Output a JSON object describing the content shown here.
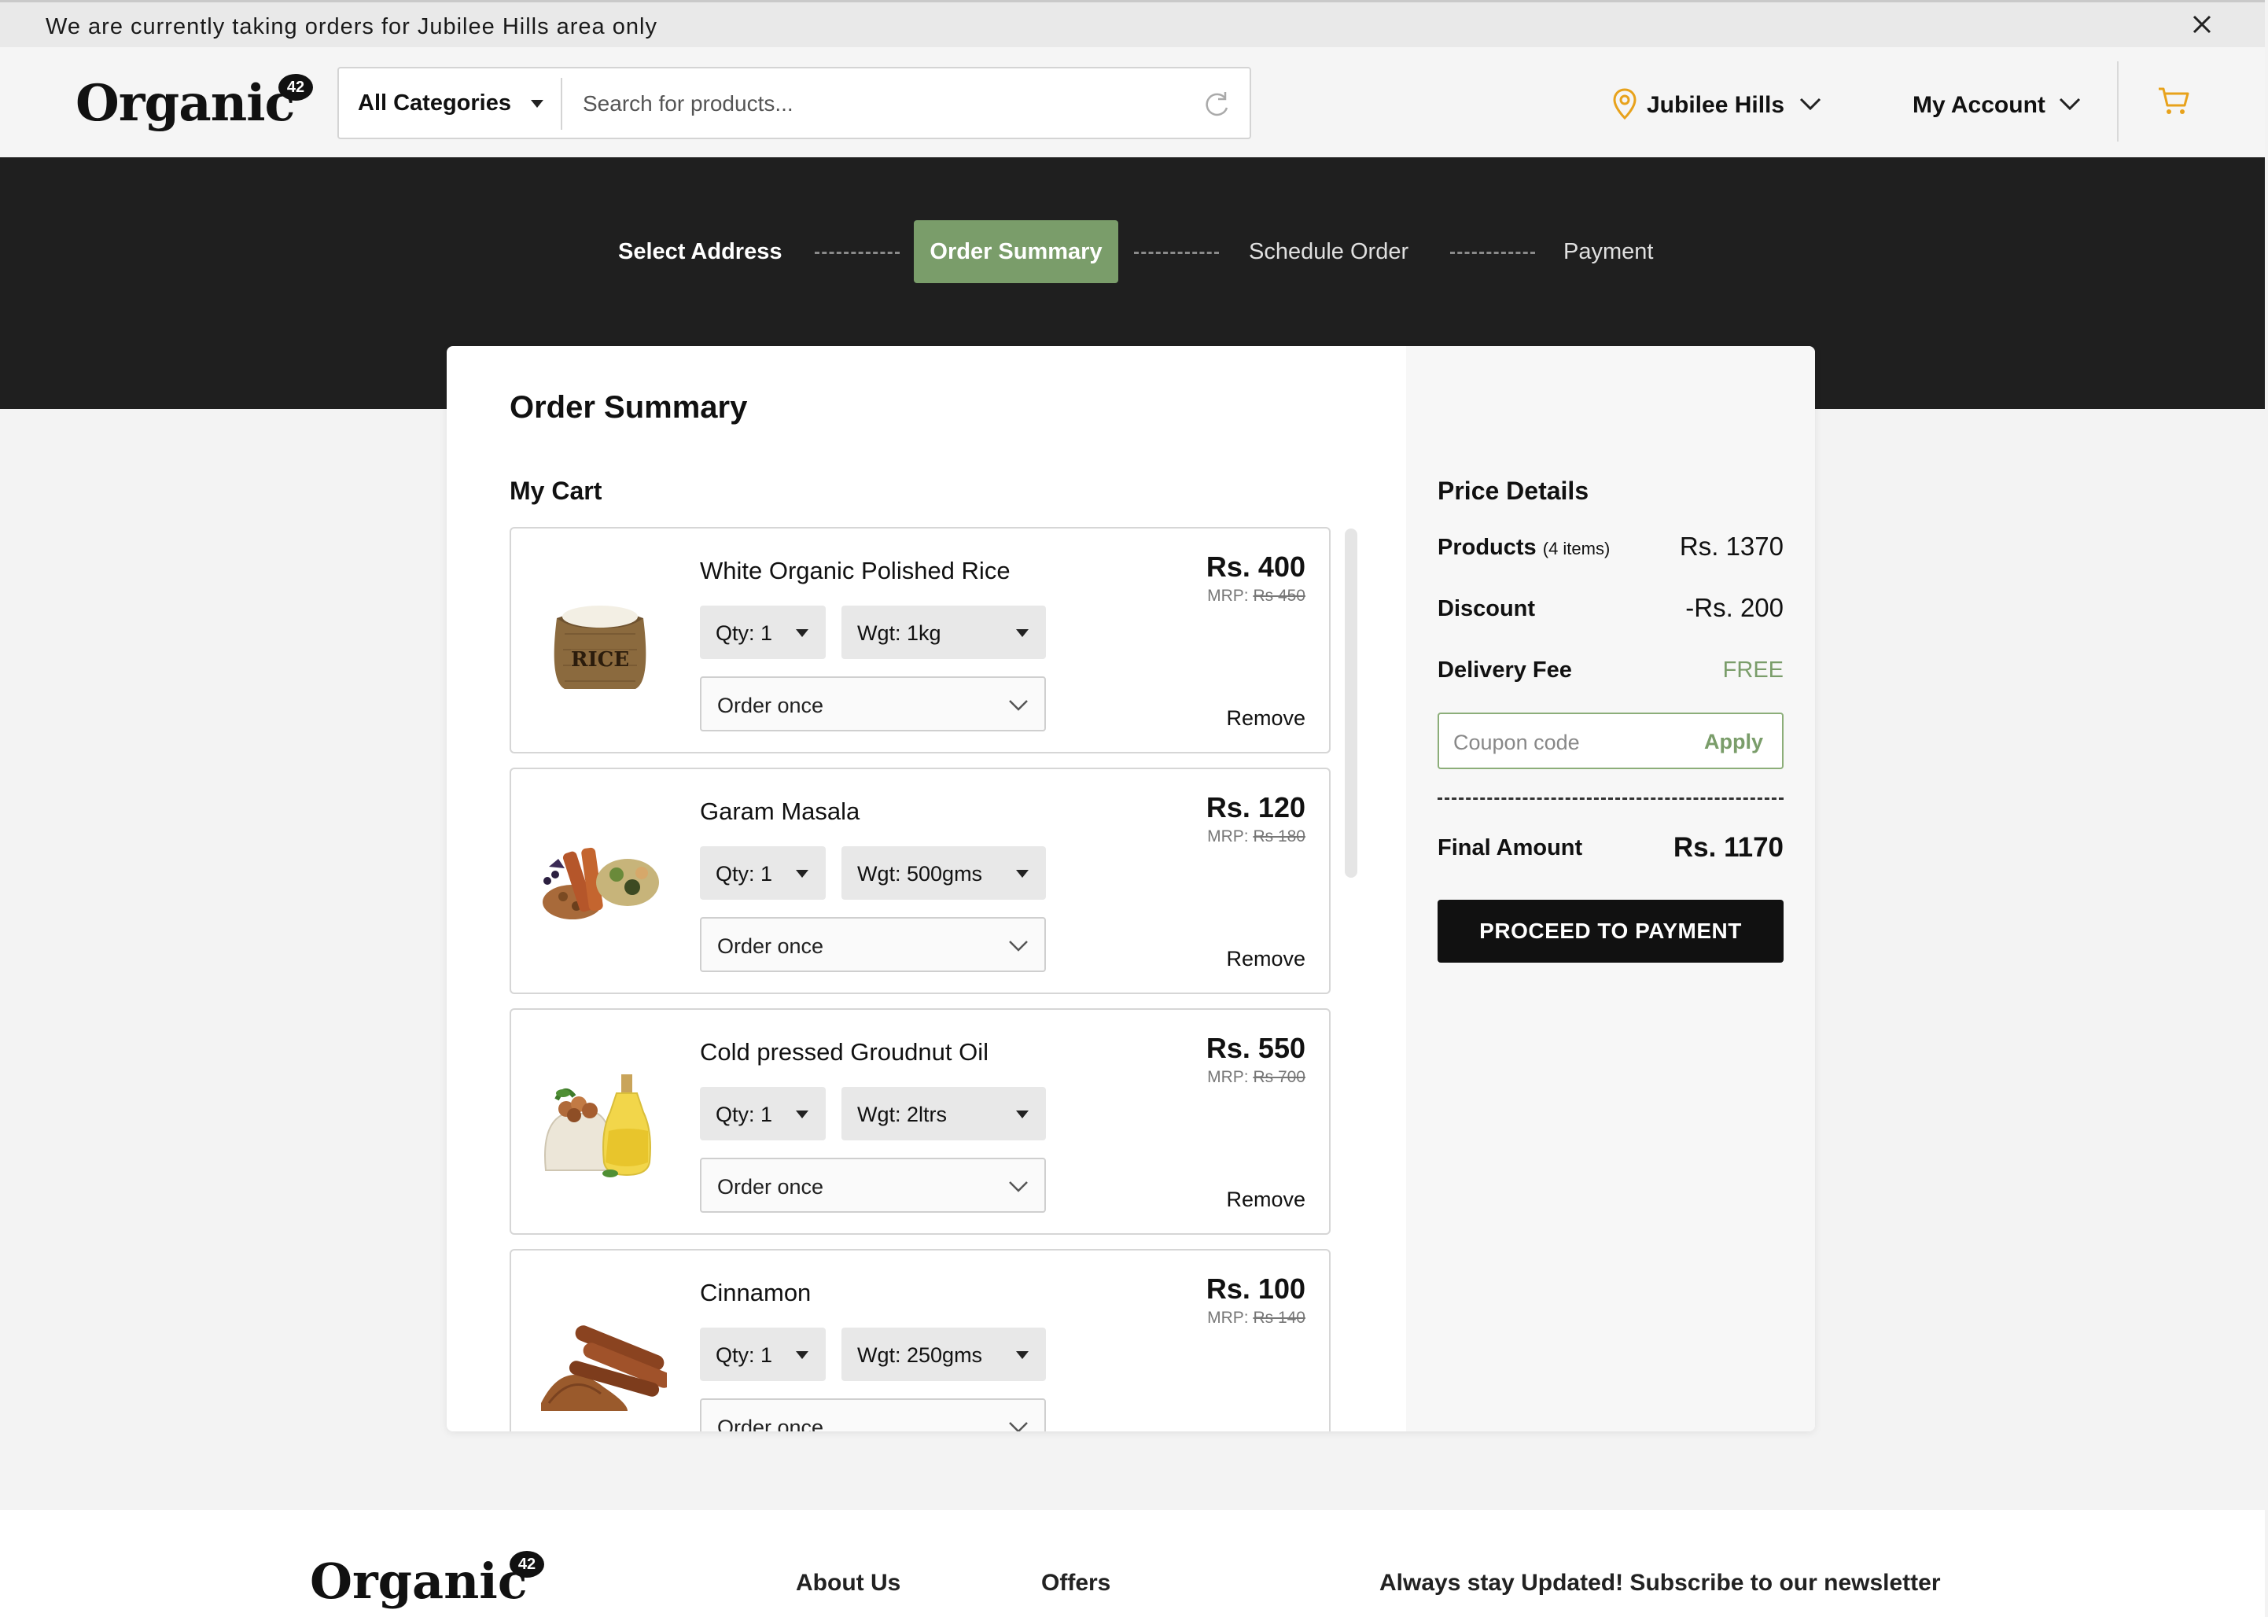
{
  "announcement": {
    "text": "We are currently taking orders for Jubilee Hills area only"
  },
  "header": {
    "logo_text": "Organic",
    "logo_badge": "42",
    "category_label": "All Categories",
    "search_placeholder": "Search for products...",
    "location_label": "Jubilee Hills",
    "account_label": "My Account"
  },
  "steps": [
    {
      "label": "Select Address",
      "state": "done"
    },
    {
      "label": "Order Summary",
      "state": "active"
    },
    {
      "label": "Schedule Order",
      "state": "pending"
    },
    {
      "label": "Payment",
      "state": "pending"
    }
  ],
  "order": {
    "title": "Order Summary",
    "cart_heading": "My Cart",
    "remove_label": "Remove",
    "items": [
      {
        "name": "White Organic Polished Rice",
        "qty": "Qty: 1",
        "weight": "Wgt: 1kg",
        "frequency": "Order once",
        "price": "Rs. 400",
        "mrp_label": "MRP:",
        "mrp": "Rs 450"
      },
      {
        "name": "Garam Masala",
        "qty": "Qty: 1",
        "weight": "Wgt: 500gms",
        "frequency": "Order once",
        "price": "Rs. 120",
        "mrp_label": "MRP:",
        "mrp": "Rs 180"
      },
      {
        "name": "Cold pressed Groudnut Oil",
        "qty": "Qty: 1",
        "weight": "Wgt: 2ltrs",
        "frequency": "Order once",
        "price": "Rs. 550",
        "mrp_label": "MRP:",
        "mrp": "Rs 700"
      },
      {
        "name": "Cinnamon",
        "qty": "Qty: 1",
        "weight": "Wgt: 250gms",
        "frequency": "Order once",
        "price": "Rs. 100",
        "mrp_label": "MRP:",
        "mrp": "Rs 140"
      }
    ]
  },
  "price_details": {
    "title": "Price Details",
    "products_label": "Products",
    "products_count": "(4 items)",
    "products_value": "Rs. 1370",
    "discount_label": "Discount",
    "discount_value": "-Rs. 200",
    "delivery_label": "Delivery Fee",
    "delivery_value": "FREE",
    "coupon_placeholder": "Coupon code",
    "apply_label": "Apply",
    "final_label": "Final Amount",
    "final_value": "Rs. 1170",
    "proceed_label": "PROCEED TO PAYMENT"
  },
  "footer": {
    "logo_text": "Organic",
    "logo_badge": "42",
    "links": [
      "About Us",
      "Offers"
    ],
    "newsletter_text": "Always stay Updated! Subscribe to our newsletter"
  },
  "colors": {
    "accent": "#7a9d6a",
    "dark_band": "#1f1f1f",
    "cart_icon": "#e8a21b",
    "location_pin": "#e8a21b"
  },
  "icons": [
    "close-icon",
    "search-refresh-icon",
    "location-pin-icon",
    "chevron-down-icon",
    "cart-icon"
  ]
}
